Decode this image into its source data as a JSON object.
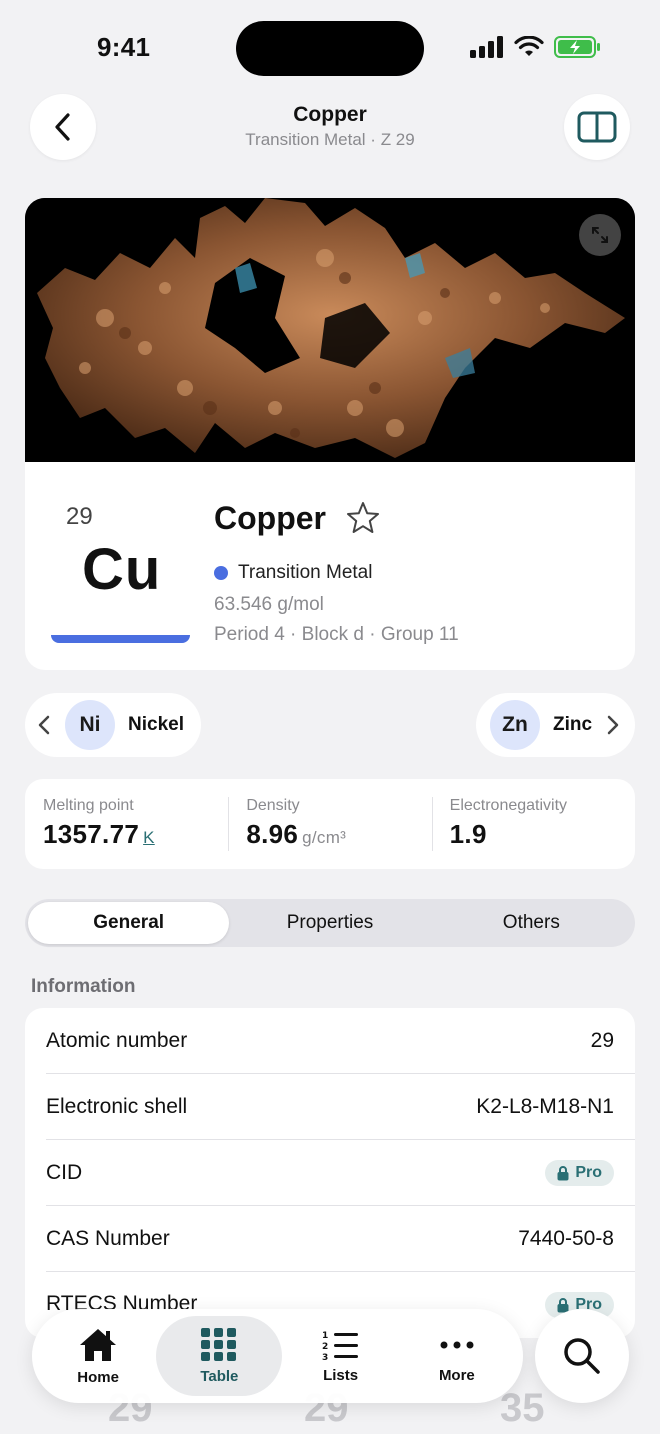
{
  "status_bar": {
    "time": "9:41"
  },
  "header": {
    "title": "Copper",
    "subtitle": "Transition Metal · Z 29"
  },
  "element": {
    "atomic_number": "29",
    "symbol": "Cu",
    "name": "Copper",
    "category": "Transition Metal",
    "category_color": "#4a6ee0",
    "atomic_mass": "63.546 g/mol",
    "position": "Period 4 · Block d · Group 11"
  },
  "neighbors": {
    "prev": {
      "symbol": "Ni",
      "name": "Nickel"
    },
    "next": {
      "symbol": "Zn",
      "name": "Zinc"
    }
  },
  "quick_stats": [
    {
      "label": "Melting point",
      "value": "1357.77",
      "unit": "K"
    },
    {
      "label": "Density",
      "value": "8.96",
      "unit": "g/cm³"
    },
    {
      "label": "Electronegativity",
      "value": "1.9",
      "unit": ""
    }
  ],
  "tabs": {
    "general": "General",
    "properties": "Properties",
    "others": "Others"
  },
  "info": {
    "title": "Information",
    "pro_label": "Pro",
    "rows": [
      {
        "label": "Atomic number",
        "value": "29"
      },
      {
        "label": "Electronic shell",
        "value": "K2-L8-M18-N1"
      },
      {
        "label": "CID",
        "value": ""
      },
      {
        "label": "CAS Number",
        "value": "7440-50-8"
      },
      {
        "label": "RTECS Number",
        "value": ""
      }
    ]
  },
  "behind_values": [
    "29",
    "29",
    "35"
  ],
  "tabbar": {
    "home": "Home",
    "table": "Table",
    "lists": "Lists",
    "more": "More"
  },
  "colors": {
    "accent": "#2a6f74",
    "category": "#4a6ee0",
    "background": "#f2f2f4"
  }
}
